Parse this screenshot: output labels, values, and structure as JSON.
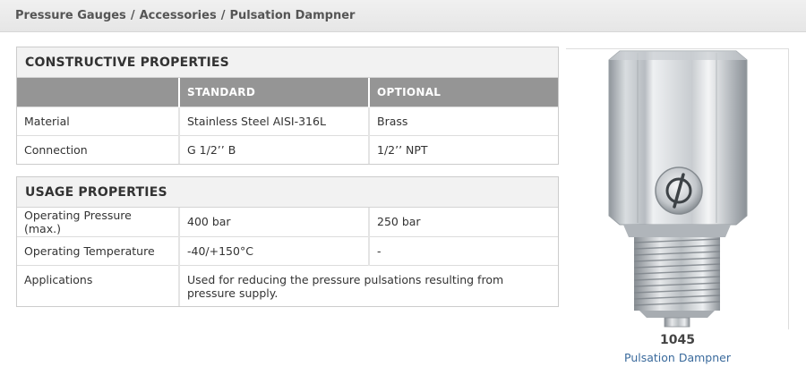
{
  "breadcrumb": [
    "Pressure Gauges",
    "Accessories",
    "Pulsation Dampner"
  ],
  "breadcrumb_separator": "/",
  "constructive": {
    "title": "CONSTRUCTIVE PROPERTIES",
    "headers": [
      "",
      "STANDARD",
      "OPTIONAL"
    ],
    "rows": [
      [
        "Material",
        "Stainless Steel AISI-316L",
        "Brass"
      ],
      [
        "Connection",
        "G 1/2’’ B",
        "1/2’’ NPT"
      ]
    ]
  },
  "usage": {
    "title": "USAGE PROPERTIES",
    "rows": [
      [
        "Operating Pressure (max.)",
        "400 bar",
        "250 bar"
      ],
      [
        "Operating Temperature",
        "-40/+150°C",
        "-"
      ]
    ],
    "applications_label": "Applications",
    "applications_text": "Used for reducing the pressure pulsations resulting from pressure supply."
  },
  "product": {
    "code": "1045",
    "name": "Pulsation Dampner",
    "image_icon": "pulsation-dampner-photo"
  },
  "colors": {
    "header_bg": "#959595",
    "link": "#3a6a9c"
  }
}
